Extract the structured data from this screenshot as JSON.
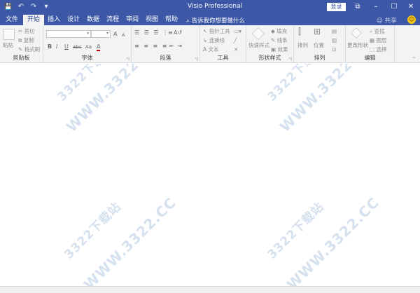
{
  "window": {
    "title": "Visio Professional",
    "login_label": "登录",
    "controls": {
      "restore_ribbon": "⧉",
      "minimize": "–",
      "maximize": "☐",
      "close": "✕"
    }
  },
  "quick_access": {
    "save_icon": "💾",
    "undo_icon": "↶",
    "redo_icon": "↷",
    "customize_icon": "▾"
  },
  "tabs": [
    "文件",
    "开始",
    "插入",
    "设计",
    "数据",
    "流程",
    "审阅",
    "视图",
    "帮助"
  ],
  "active_tab": "开始",
  "tell_me": "告诉我你想要做什么",
  "share_label": "共享",
  "ribbon": {
    "clipboard": {
      "label": "剪贴板",
      "paste": "粘贴",
      "cut": "剪切",
      "copy": "复制",
      "format_painter": "格式刷"
    },
    "font": {
      "label": "字体",
      "grow": "A",
      "shrink": "A",
      "bold": "B",
      "italic": "I",
      "underline": "U",
      "strike": "abc",
      "case": "Aa",
      "color": "A"
    },
    "paragraph": {
      "label": "段落"
    },
    "tools": {
      "label": "工具",
      "pointer": "指针工具",
      "connector": "连接线",
      "text": "文本"
    },
    "shape_styles": {
      "label": "形状样式",
      "quick_styles": "快速样式",
      "fill": "填充",
      "line": "线条",
      "effects": "效果"
    },
    "arrange": {
      "label": "排列",
      "align": "排列",
      "position": "位置"
    },
    "editing": {
      "label": "编辑",
      "change_shape": "更改形状",
      "find": "查找",
      "layers": "图层",
      "select": "选择"
    }
  },
  "watermark": "WWW.3322.CC",
  "watermark_sub": "3322下载站",
  "colors": {
    "accent": "#3b57a6",
    "ribbon_bg": "#f3f3f3",
    "watermark": "#d5e1ee"
  }
}
